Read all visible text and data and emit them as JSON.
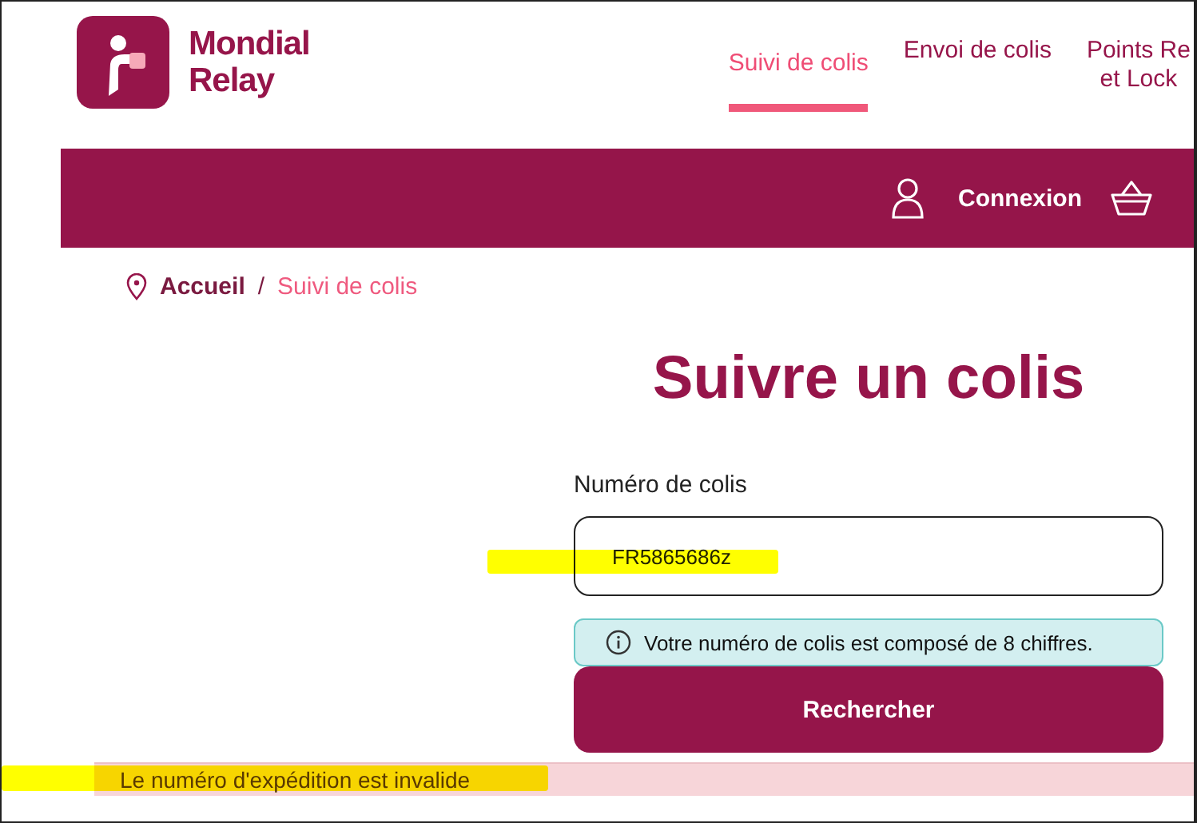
{
  "header": {
    "logo": {
      "line1": "Mondial",
      "line2": "Relay"
    },
    "nav": [
      {
        "label": "Suivi de colis",
        "selected": true
      },
      {
        "label": "Envoi de colis",
        "selected": false
      },
      {
        "label": "Points Re\net Lock",
        "selected": false
      }
    ]
  },
  "account_bar": {
    "login": "Connexion"
  },
  "breadcrumb": [
    {
      "label": "Accueil",
      "selected": false
    },
    {
      "label": "Suivi de colis",
      "selected": true
    }
  ],
  "breadcrumb_separator": "/",
  "title": "Suivre un colis",
  "form": {
    "label": "Numéro de colis",
    "value": "FR5865686z",
    "hint": "Votre numéro de colis est composé de 8 chiffres.",
    "button": "Rechercher"
  },
  "error": "Le numéro d'expédition est invalide"
}
